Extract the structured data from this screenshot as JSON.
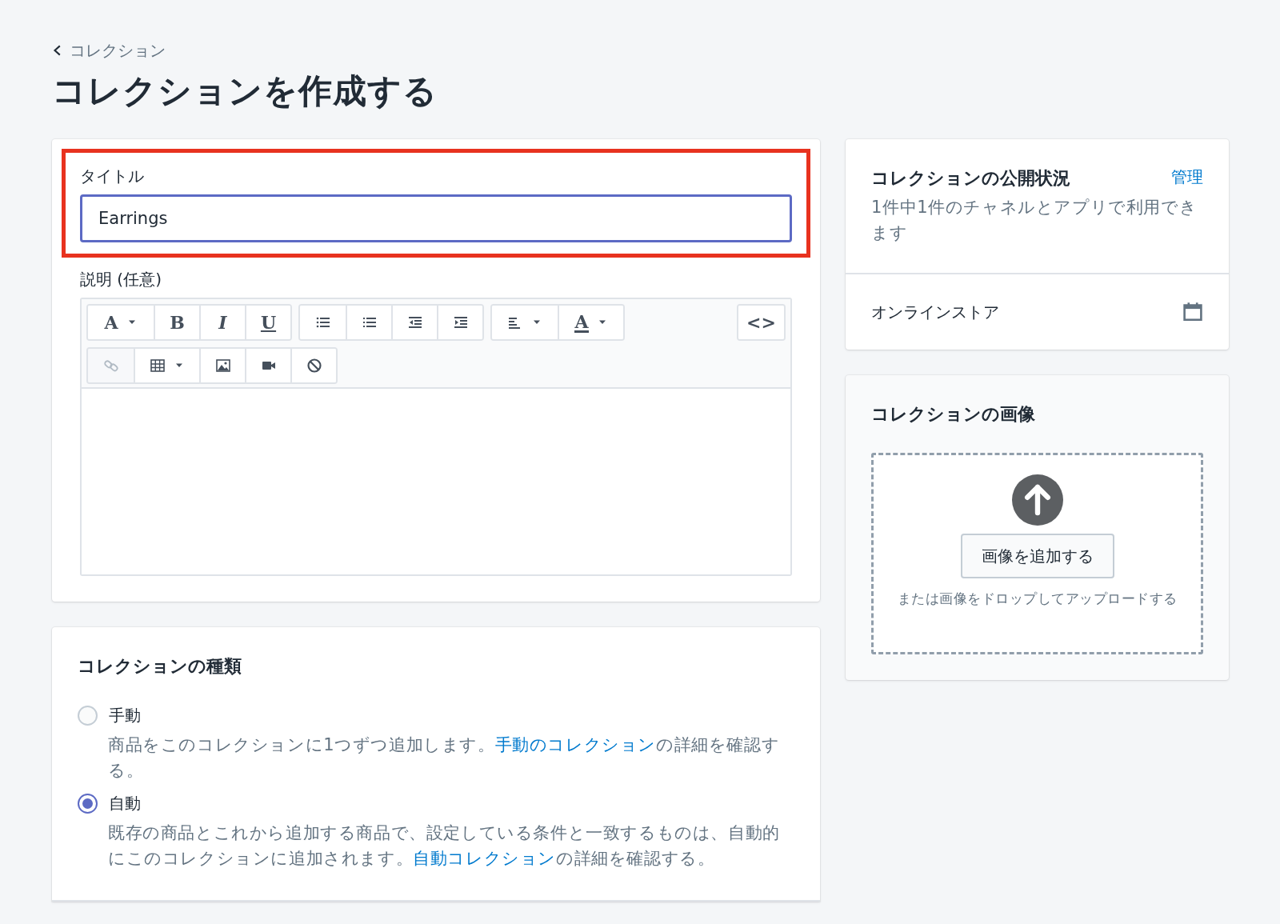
{
  "breadcrumb": {
    "label": "コレクション"
  },
  "page_title": "コレクションを作成する",
  "title_field": {
    "label": "タイトル",
    "value": "Earrings",
    "focused": true,
    "highlighted": true
  },
  "description": {
    "label": "説明 (任意)",
    "toolbar_rows": [
      [
        [
          {
            "kind": "glyph",
            "label": "A",
            "dropdown": true,
            "disabled": false
          },
          {
            "kind": "glyph",
            "label": "B",
            "dropdown": false,
            "disabled": false
          },
          {
            "kind": "glyph",
            "label": "I",
            "dropdown": false,
            "disabled": false
          },
          {
            "kind": "glyph",
            "label": "U",
            "dropdown": false,
            "disabled": false
          }
        ],
        [
          {
            "kind": "bullet-list",
            "dropdown": false,
            "disabled": false
          },
          {
            "kind": "numbered-list",
            "dropdown": false,
            "disabled": false
          },
          {
            "kind": "outdent",
            "dropdown": false,
            "disabled": false
          },
          {
            "kind": "indent",
            "dropdown": false,
            "disabled": false
          }
        ],
        [
          {
            "kind": "align",
            "dropdown": true,
            "disabled": false
          },
          {
            "kind": "glyph-underlined",
            "label": "A",
            "dropdown": true,
            "disabled": false
          }
        ],
        [
          {
            "kind": "glyph",
            "label": "<>",
            "dropdown": false,
            "disabled": false
          }
        ]
      ],
      [
        [
          {
            "kind": "link",
            "dropdown": false,
            "disabled": true
          },
          {
            "kind": "table",
            "dropdown": true,
            "disabled": false
          },
          {
            "kind": "image",
            "dropdown": false,
            "disabled": false
          },
          {
            "kind": "video",
            "dropdown": false,
            "disabled": false
          },
          {
            "kind": "clear",
            "dropdown": false,
            "disabled": false
          }
        ]
      ]
    ]
  },
  "collection_type": {
    "heading": "コレクションの種類",
    "options": [
      {
        "label": "手動",
        "selected": false,
        "text_before": "商品をこのコレクションに1つずつ追加します。",
        "link": "手動のコレクション",
        "text_after": "の詳細を確認する。"
      },
      {
        "label": "自動",
        "selected": true,
        "text_before": "既存の商品とこれから追加する商品で、設定している条件と一致するものは、自動的にこのコレクションに追加されます。",
        "link": "自動コレクション",
        "text_after": "の詳細を確認する。"
      }
    ]
  },
  "availability": {
    "heading": "コレクションの公開状況",
    "action": "管理",
    "summary": "1件中1件のチャネルとアプリで利用できます",
    "channels": [
      {
        "name": "オンラインストア"
      }
    ]
  },
  "image": {
    "heading": "コレクションの画像",
    "button": "画像を追加する",
    "hint": "または画像をドロップしてアップロードする"
  }
}
